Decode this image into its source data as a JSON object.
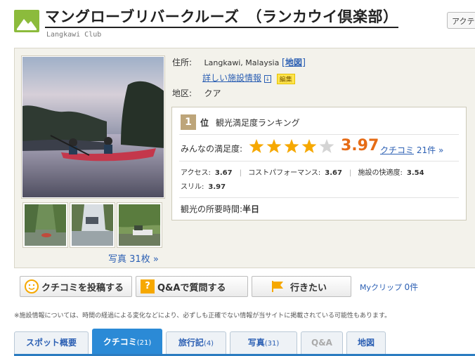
{
  "header": {
    "title": "マングローブリバークルーズ　（ランカウイ倶楽部）",
    "subtitle": "Langkawi Club",
    "action_tab": "アクテ"
  },
  "info": {
    "address_label": "住所:",
    "address_value": "Langkawi, Malaysia",
    "map_bracket_open": "[",
    "map_link": "地図",
    "map_bracket_close": "]",
    "details_link": "詳しい施設情報",
    "details_icon": "↓",
    "edit_badge": "編集",
    "district_label": "地区:",
    "district_value": "クア"
  },
  "photos": {
    "count_label": "写真",
    "count_value": "31枚",
    "count_arrow": "»"
  },
  "ranking": {
    "rank_number": "1",
    "rank_suffix": "位",
    "rank_title": "観光満足度ランキング",
    "satisfaction_label": "みんなの満足度:",
    "rating": 3.97,
    "score_text": "3.97",
    "review_link": "クチコミ",
    "review_count": "21件",
    "review_arrow": "»",
    "sub_scores": [
      {
        "label": "アクセス:",
        "value": "3.67"
      },
      {
        "label": "コストパフォーマンス:",
        "value": "3.67"
      },
      {
        "label": "施設の快適度:",
        "value": "3.54"
      },
      {
        "label": "スリル:",
        "value": "3.97"
      }
    ],
    "duration_label": "観光の所要時間:",
    "duration_value": "半日"
  },
  "actions": {
    "post_review": "クチコミを投稿する",
    "ask_question": "Q&Aで質問する",
    "want_to_go": "行きたい",
    "clip_label": "Myクリップ",
    "clip_count": "0件"
  },
  "notice": "※施設情報については、時間の経過による変化などにより、必ずしも正確でない情報が当サイトに掲載されている可能性もあります。",
  "tabs": [
    {
      "label": "スポット概要",
      "count": ""
    },
    {
      "label": "クチコミ",
      "count": "(21)"
    },
    {
      "label": "旅行記",
      "count": "(4)"
    },
    {
      "label": "写真",
      "count": "(31)"
    },
    {
      "label": "Q&A",
      "count": ""
    },
    {
      "label": "地図",
      "count": ""
    }
  ],
  "colors": {
    "accent_orange": "#e66c16",
    "link_blue": "#2b5fb3",
    "tab_active": "#2b8ad6",
    "logo_green": "#8cbb3c",
    "star_gold": "#f6a800"
  }
}
